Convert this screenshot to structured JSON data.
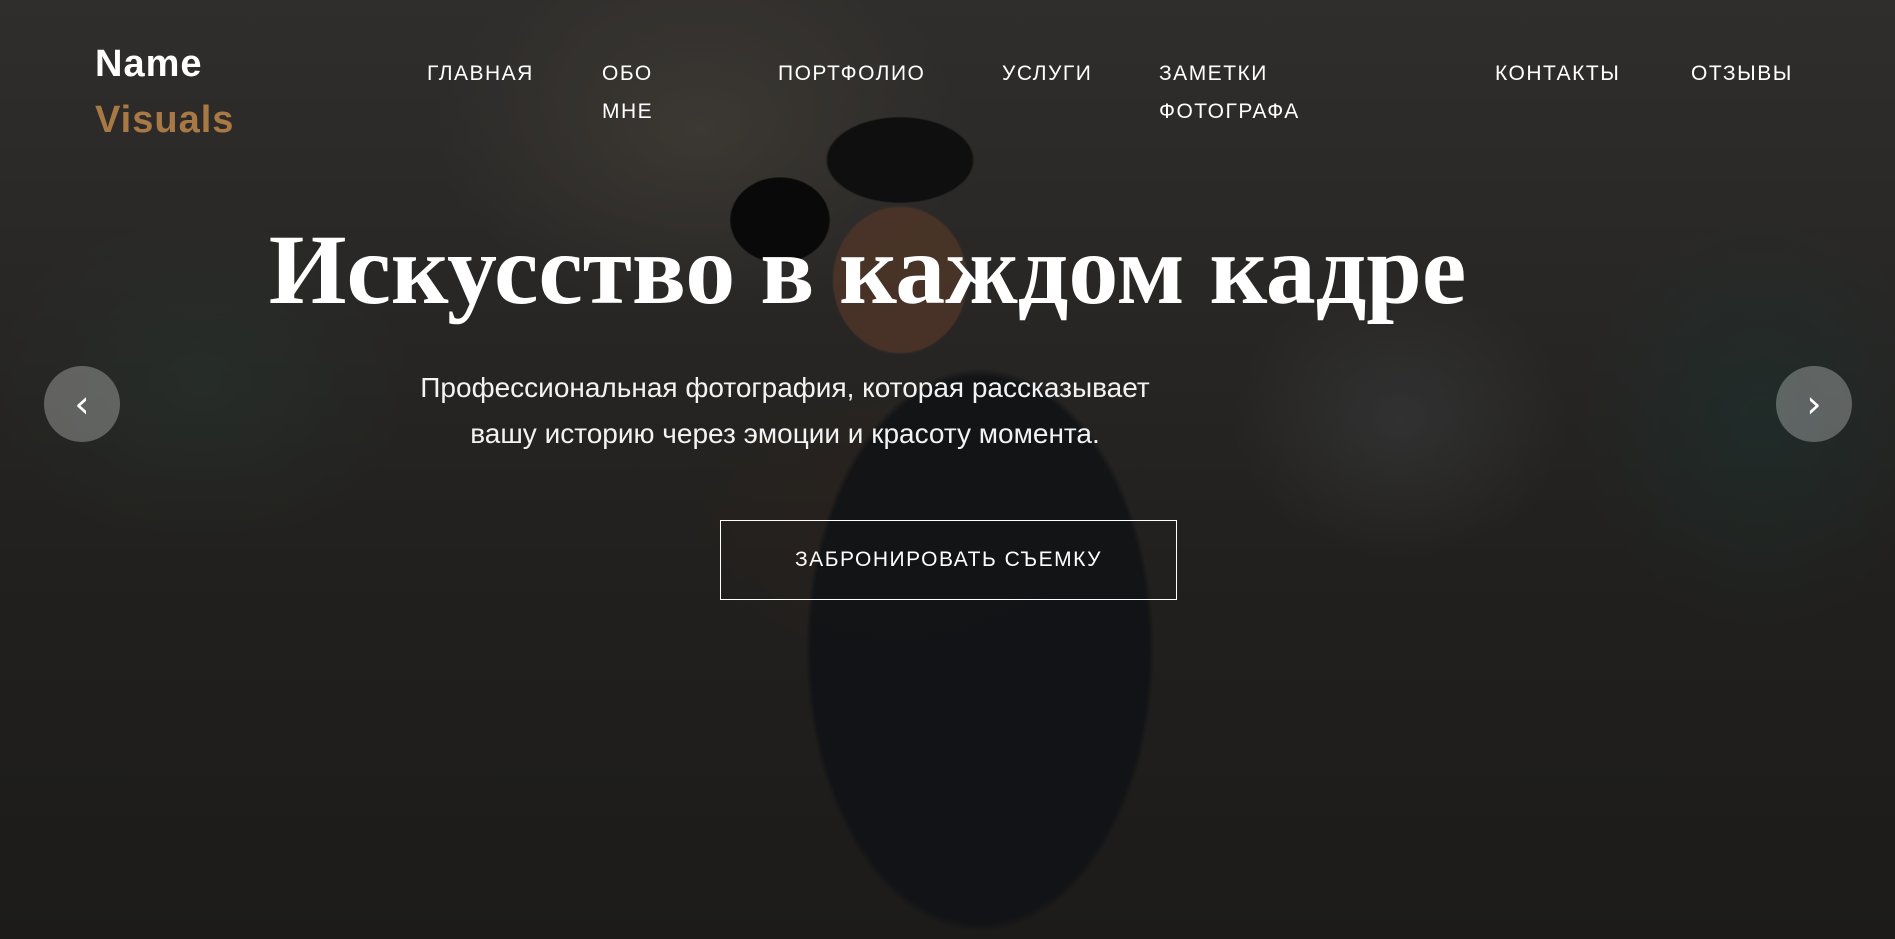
{
  "brand": {
    "name_line1": "Name",
    "name_line2": "Visuals",
    "accent_color": "#a87945"
  },
  "nav": {
    "items": [
      {
        "label_line1": "ГЛАВНАЯ",
        "label_line2": ""
      },
      {
        "label_line1": "ОБО",
        "label_line2": "МНЕ"
      },
      {
        "label_line1": "ПОРТФОЛИО",
        "label_line2": ""
      },
      {
        "label_line1": "УСЛУГИ",
        "label_line2": ""
      },
      {
        "label_line1": "ЗАМЕТКИ",
        "label_line2": "ФОТОГРАФА"
      },
      {
        "label_line1": "КОНТАКТЫ",
        "label_line2": ""
      },
      {
        "label_line1": "ОТЗЫВЫ",
        "label_line2": ""
      }
    ]
  },
  "hero": {
    "headline": "Искусство в каждом кадре",
    "subtitle_line1": "Профессиональная фотография, которая рассказывает",
    "subtitle_line2": "вашу историю через эмоции и красоту момента.",
    "cta_label": "ЗАБРОНИРОВАТЬ СЪЕМКУ",
    "prev_icon": "chevron-left-icon",
    "next_icon": "chevron-right-icon",
    "prev_glyph": "‹",
    "next_glyph": "›"
  }
}
